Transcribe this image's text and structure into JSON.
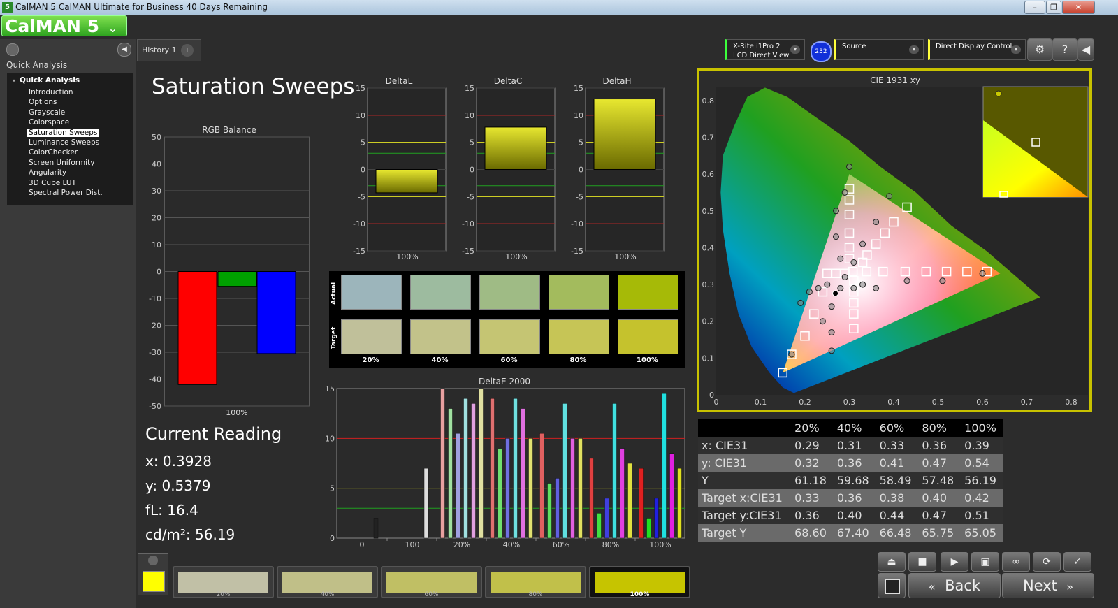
{
  "window": {
    "title": "CalMAN 5 CalMAN Ultimate for Business 40 Days Remaining",
    "icon_text": "5",
    "minimize": "–",
    "maximize": "❐",
    "close": "✕"
  },
  "logo": {
    "text": "CalMAN 5",
    "menu_glyph": "⌄"
  },
  "sidebar": {
    "heading": "Quick Analysis",
    "group": "Quick Analysis",
    "items": [
      "Introduction",
      "Options",
      "Grayscale",
      "Colorspace",
      "Saturation Sweeps",
      "Luminance Sweeps",
      "ColorChecker",
      "Screen Uniformity",
      "Angularity",
      "3D Cube LUT",
      "Spectral Power Dist."
    ],
    "selected_index": 4
  },
  "tabs": {
    "history": "History 1",
    "add": "+"
  },
  "header": {
    "meter": {
      "line1": "X-Rite i1Pro 2",
      "line2": "LCD Direct View"
    },
    "meter_badge": "232",
    "source": "Source",
    "display": "Direct Display Control",
    "settings_icon": "gear-icon",
    "help": "?",
    "collapse": "◀"
  },
  "page": {
    "title": "Saturation Sweeps"
  },
  "rgb_balance": {
    "title": "RGB Balance",
    "ticks": [
      50,
      40,
      30,
      20,
      10,
      0,
      -10,
      -20,
      -30,
      -40,
      -50
    ],
    "ylim": [
      -50,
      50
    ],
    "category": "100%",
    "values": {
      "red": -42,
      "green": -5.5,
      "blue": -30.5
    },
    "colors": {
      "red": "#ff0000",
      "green": "#00a000",
      "blue": "#0000ff"
    }
  },
  "delta_charts": [
    {
      "title": "DeltaL",
      "value": -4.3,
      "category": "100%"
    },
    {
      "title": "DeltaC",
      "value": 7.8,
      "category": "100%"
    },
    {
      "title": "DeltaH",
      "value": 13,
      "category": "100%"
    }
  ],
  "delta_ticks": [
    15,
    10,
    5,
    0,
    -5,
    -10,
    -15
  ],
  "swatches": {
    "actual_label": "Actual",
    "target_label": "Target",
    "labels": [
      "20%",
      "40%",
      "60%",
      "80%",
      "100%"
    ],
    "actual": [
      "#9cb5bb",
      "#9dbb9f",
      "#9fbb85",
      "#a3bb5d",
      "#a6ba07"
    ],
    "target": [
      "#c0c09a",
      "#c2c28a",
      "#c5c573",
      "#c6c556",
      "#c5c22d"
    ]
  },
  "current_reading": {
    "title": "Current Reading",
    "x": "x: 0.3928",
    "y": "y: 0.5379",
    "fl": "fL: 16.4",
    "cdm2": "cd/m²: 56.19"
  },
  "cie": {
    "title": "CIE 1931 xy",
    "xticks": [
      "0",
      "0.1",
      "0.2",
      "0.3",
      "0.4",
      "0.5",
      "0.6",
      "0.7",
      "0.8"
    ],
    "yticks": [
      "0",
      "0.1",
      "0.2",
      "0.3",
      "0.4",
      "0.5",
      "0.6",
      "0.7",
      "0.8"
    ]
  },
  "table": {
    "headers": [
      "",
      "20%",
      "40%",
      "60%",
      "80%",
      "100%"
    ],
    "rows": [
      [
        "x: CIE31",
        "0.29",
        "0.31",
        "0.33",
        "0.36",
        "0.39"
      ],
      [
        "y: CIE31",
        "0.32",
        "0.36",
        "0.41",
        "0.47",
        "0.54"
      ],
      [
        "Y",
        "61.18",
        "59.68",
        "58.49",
        "57.48",
        "56.19"
      ],
      [
        "Target x:CIE31",
        "0.33",
        "0.36",
        "0.38",
        "0.40",
        "0.42"
      ],
      [
        "Target y:CIE31",
        "0.36",
        "0.40",
        "0.44",
        "0.47",
        "0.51"
      ],
      [
        "Target Y",
        "68.60",
        "67.40",
        "66.48",
        "65.75",
        "65.05"
      ]
    ]
  },
  "chart_data": [
    {
      "type": "bar",
      "title": "RGB Balance",
      "categories": [
        "100%"
      ],
      "series": [
        {
          "name": "R",
          "values": [
            -42
          ]
        },
        {
          "name": "G",
          "values": [
            -5.5
          ]
        },
        {
          "name": "B",
          "values": [
            -30.5
          ]
        }
      ],
      "ylim": [
        -50,
        50
      ]
    },
    {
      "type": "bar",
      "title": "DeltaL",
      "categories": [
        "100%"
      ],
      "values": [
        -4.3
      ],
      "ylim": [
        -15,
        15
      ]
    },
    {
      "type": "bar",
      "title": "DeltaC",
      "categories": [
        "100%"
      ],
      "values": [
        7.8
      ],
      "ylim": [
        -15,
        15
      ]
    },
    {
      "type": "bar",
      "title": "DeltaH",
      "categories": [
        "100%"
      ],
      "values": [
        13
      ],
      "ylim": [
        -15,
        15
      ]
    },
    {
      "type": "bar",
      "title": "DeltaE 2000",
      "ylim": [
        0,
        15
      ],
      "xticks": [
        "0",
        "100",
        "20%",
        "40%",
        "60%",
        "80%",
        "100%"
      ],
      "groups": [
        {
          "bars": [
            {
              "v": 2,
              "c": "#222222"
            }
          ]
        },
        {
          "bars": [
            {
              "v": 7,
              "c": "#dddddd"
            }
          ]
        },
        {
          "bars": [
            {
              "v": 15,
              "c": "#e8a0a0"
            },
            {
              "v": 13,
              "c": "#a0e0a0"
            },
            {
              "v": 10.5,
              "c": "#a0a0e0"
            },
            {
              "v": 14,
              "c": "#a0e0e0"
            },
            {
              "v": 13.5,
              "c": "#e0a0e0"
            },
            {
              "v": 15,
              "c": "#e0e0a0"
            }
          ]
        },
        {
          "bars": [
            {
              "v": 14,
              "c": "#e07070"
            },
            {
              "v": 9,
              "c": "#70e070"
            },
            {
              "v": 10,
              "c": "#7070e0"
            },
            {
              "v": 14,
              "c": "#70e0e0"
            },
            {
              "v": 13,
              "c": "#e070e0"
            },
            {
              "v": 10,
              "c": "#e0e070"
            }
          ]
        },
        {
          "bars": [
            {
              "v": 10.5,
              "c": "#e06060"
            },
            {
              "v": 5.5,
              "c": "#60e060"
            },
            {
              "v": 6,
              "c": "#6060e0"
            },
            {
              "v": 13.5,
              "c": "#60e0e0"
            },
            {
              "v": 10,
              "c": "#e060e0"
            },
            {
              "v": 10,
              "c": "#e0e060"
            }
          ]
        },
        {
          "bars": [
            {
              "v": 8,
              "c": "#e04040"
            },
            {
              "v": 2.5,
              "c": "#40e040"
            },
            {
              "v": 4,
              "c": "#4040e0"
            },
            {
              "v": 13.5,
              "c": "#40e0e0"
            },
            {
              "v": 9,
              "c": "#e040e0"
            },
            {
              "v": 7.5,
              "c": "#e0e040"
            }
          ]
        },
        {
          "bars": [
            {
              "v": 7,
              "c": "#e02020"
            },
            {
              "v": 2,
              "c": "#20e020"
            },
            {
              "v": 4,
              "c": "#2020e0"
            },
            {
              "v": 14.5,
              "c": "#20e0e0"
            },
            {
              "v": 8.5,
              "c": "#e020e0"
            },
            {
              "v": 7,
              "c": "#e0e020"
            }
          ]
        }
      ]
    },
    {
      "type": "scatter",
      "title": "CIE 1931 xy",
      "xlim": [
        0,
        0.8
      ],
      "ylim": [
        0,
        0.8
      ],
      "gamut": [
        [
          0.64,
          0.33
        ],
        [
          0.3,
          0.6
        ],
        [
          0.15,
          0.06
        ]
      ],
      "white": [
        0.3127,
        0.329
      ],
      "targets": [
        [
          0.308,
          0.335
        ],
        [
          0.339,
          0.335
        ],
        [
          0.376,
          0.335
        ],
        [
          0.426,
          0.335
        ],
        [
          0.473,
          0.335
        ],
        [
          0.519,
          0.335
        ],
        [
          0.565,
          0.335
        ],
        [
          0.61,
          0.335
        ],
        [
          0.3,
          0.56
        ],
        [
          0.3,
          0.53
        ],
        [
          0.3,
          0.49
        ],
        [
          0.3,
          0.44
        ],
        [
          0.3,
          0.4
        ],
        [
          0.3,
          0.37
        ],
        [
          0.31,
          0.31
        ],
        [
          0.31,
          0.28
        ],
        [
          0.31,
          0.25
        ],
        [
          0.31,
          0.22
        ],
        [
          0.31,
          0.18
        ],
        [
          0.29,
          0.33
        ],
        [
          0.27,
          0.33
        ],
        [
          0.25,
          0.33
        ],
        [
          0.24,
          0.28
        ],
        [
          0.22,
          0.22
        ],
        [
          0.2,
          0.16
        ],
        [
          0.17,
          0.11
        ],
        [
          0.15,
          0.06
        ],
        [
          0.43,
          0.51
        ],
        [
          0.4,
          0.47
        ],
        [
          0.38,
          0.44
        ],
        [
          0.36,
          0.41
        ],
        [
          0.34,
          0.38
        ],
        [
          0.33,
          0.36
        ]
      ],
      "actuals": [
        [
          0.29,
          0.32
        ],
        [
          0.31,
          0.36
        ],
        [
          0.33,
          0.41
        ],
        [
          0.36,
          0.47
        ],
        [
          0.39,
          0.54
        ],
        [
          0.3,
          0.62
        ],
        [
          0.29,
          0.55
        ],
        [
          0.27,
          0.5
        ],
        [
          0.27,
          0.43
        ],
        [
          0.28,
          0.37
        ],
        [
          0.25,
          0.3
        ],
        [
          0.23,
          0.29
        ],
        [
          0.21,
          0.28
        ],
        [
          0.19,
          0.25
        ],
        [
          0.17,
          0.11
        ],
        [
          0.24,
          0.2
        ],
        [
          0.26,
          0.17
        ],
        [
          0.26,
          0.12
        ],
        [
          0.31,
          0.29
        ],
        [
          0.33,
          0.3
        ],
        [
          0.36,
          0.29
        ],
        [
          0.43,
          0.31
        ],
        [
          0.51,
          0.31
        ],
        [
          0.6,
          0.33
        ],
        [
          0.26,
          0.24
        ],
        [
          0.28,
          0.29
        ]
      ]
    }
  ],
  "bottom": {
    "swatch_labels": [
      "20%",
      "40%",
      "60%",
      "80%",
      "100%"
    ],
    "swatch_colors": [
      "#c1c0a6",
      "#c0bf88",
      "#c0bf64",
      "#c1c04a",
      "#c6c400"
    ],
    "left_swatch": "#ffff00",
    "back": "Back",
    "next": "Next"
  }
}
